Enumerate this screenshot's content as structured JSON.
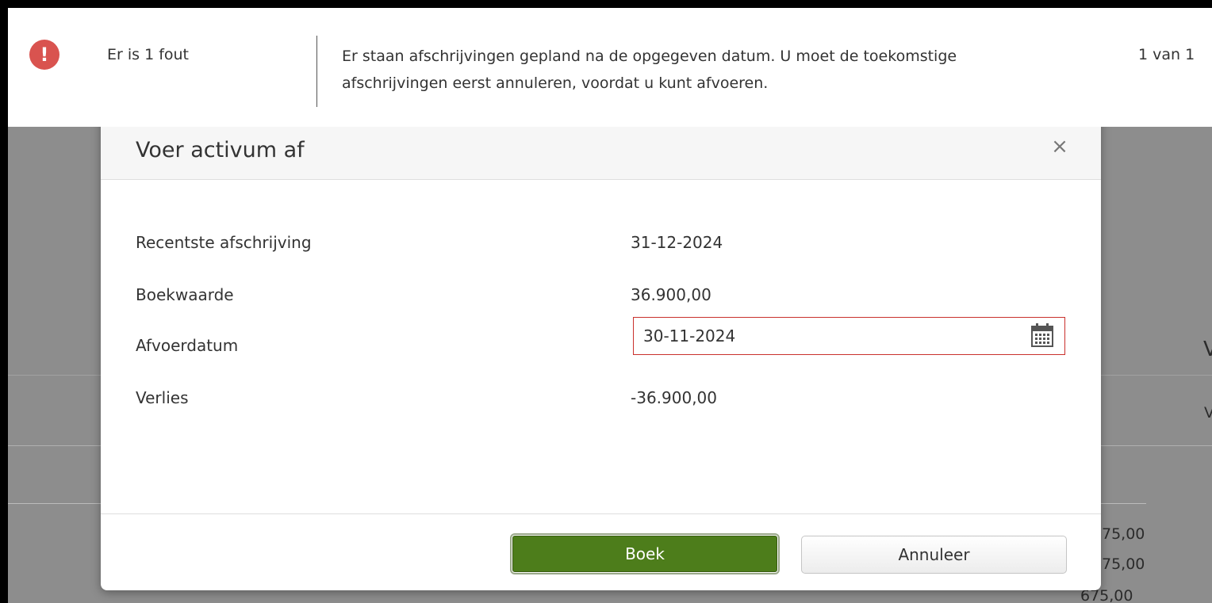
{
  "error_bar": {
    "count_text": "Er is 1 fout",
    "message": "Er staan afschrijvingen gepland na de opgegeven datum. U moet de toekomstige afschrijvingen eerst annuleren, voordat u kunt afvoeren.",
    "pager": "1 van 1",
    "icon": "exclamation-icon",
    "icon_color": "#d9534f"
  },
  "modal": {
    "title": "Voer activum af",
    "close_glyph": "×",
    "rows": [
      {
        "label": "Recentste afschrijving",
        "value": "31-12-2024"
      },
      {
        "label": "Boekwaarde",
        "value": "36.900,00"
      },
      {
        "label": "Afvoerdatum",
        "value": "30-11-2024"
      },
      {
        "label": "Verlies",
        "value": "-36.900,00"
      }
    ],
    "buttons": {
      "primary": "Boek",
      "secondary": "Annuleer"
    },
    "colors": {
      "primary": "#4d7d1b",
      "error_border": "#c9302c"
    }
  },
  "background": {
    "heading_fragment": "V",
    "subheading_fragment": "V",
    "amounts": [
      "75,00",
      "75,00",
      "675,00"
    ]
  }
}
